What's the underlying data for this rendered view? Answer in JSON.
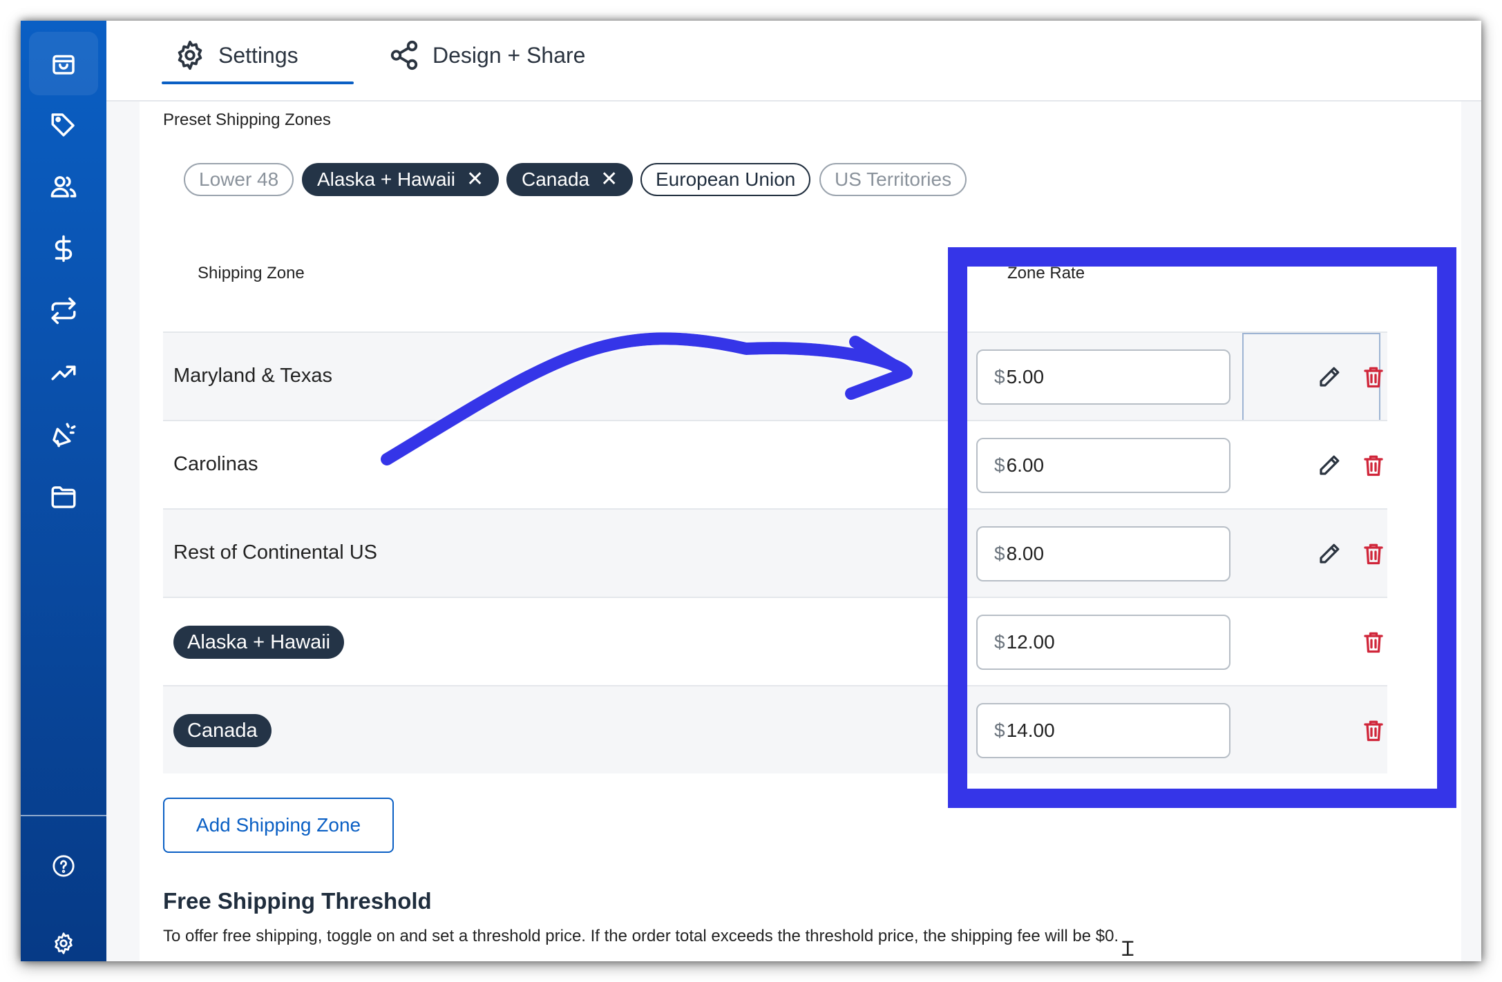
{
  "tabs": {
    "settings": "Settings",
    "design_share": "Design + Share"
  },
  "section_label": "Preset Shipping Zones",
  "preset_chips": [
    {
      "label": "Lower 48",
      "state": "available"
    },
    {
      "label": "Alaska + Hawaii",
      "state": "selected"
    },
    {
      "label": "Canada",
      "state": "selected"
    },
    {
      "label": "European Union",
      "state": "available"
    },
    {
      "label": "US Territories",
      "state": "available"
    }
  ],
  "remove_glyph": "✕",
  "table": {
    "col_zone": "Shipping Zone",
    "col_rate": "Zone Rate",
    "currency": "$",
    "rows": [
      {
        "name": "Maryland & Texas",
        "rate": "5.00",
        "preset": false
      },
      {
        "name": "Carolinas",
        "rate": "6.00",
        "preset": false
      },
      {
        "name": "Rest of Continental US",
        "rate": "8.00",
        "preset": false
      },
      {
        "name": "Alaska + Hawaii",
        "rate": "12.00",
        "preset": true
      },
      {
        "name": "Canada",
        "rate": "14.00",
        "preset": true
      }
    ]
  },
  "add_button": "Add Shipping Zone",
  "free_shipping": {
    "title": "Free Shipping Threshold",
    "description": "To offer free shipping, toggle on and set a threshold price. If the order total exceeds the threshold price, the shipping fee will be $0."
  },
  "colors": {
    "sidebar": "#0a5fc4",
    "accent": "#0a5fc4",
    "delete": "#d0263a",
    "annotation": "#3535e8",
    "chip_dark": "#243447"
  },
  "icons": {
    "sidebar": [
      "bag-icon",
      "tag-icon",
      "users-icon",
      "dollar-icon",
      "repeat-icon",
      "trending-icon",
      "megaphone-icon",
      "folder-icon",
      "help-icon",
      "gear-icon"
    ],
    "row_actions": [
      "pencil-icon",
      "trash-icon"
    ]
  }
}
